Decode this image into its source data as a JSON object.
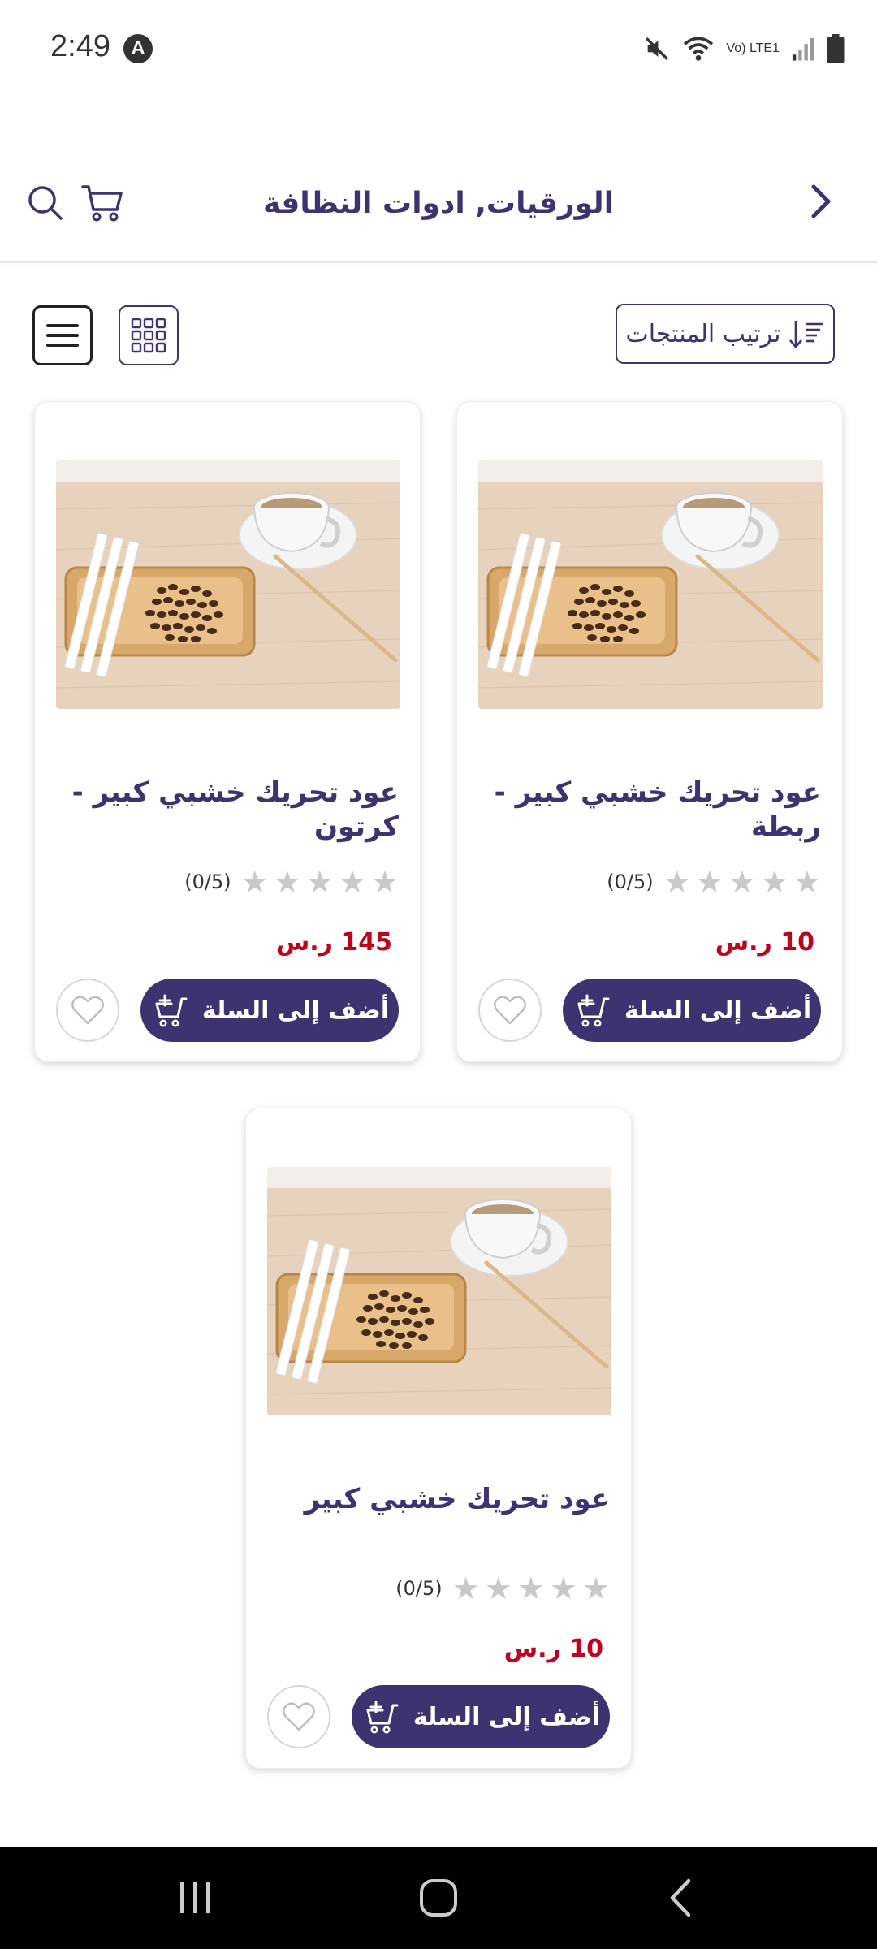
{
  "status_bar": {
    "time": "2:49",
    "app_badge": "A",
    "network_label": "Vo) LTE1",
    "icons": [
      "mute-icon",
      "wifi-icon",
      "signal-icon",
      "battery-icon"
    ]
  },
  "header": {
    "title": "الورقيات, ادوات النظافة",
    "icons": [
      "back-chevron-icon",
      "cart-icon",
      "search-icon"
    ]
  },
  "toolbar": {
    "sort_label": "ترتيب المنتجات",
    "view_modes": [
      "grid-view-icon",
      "list-view-icon"
    ]
  },
  "products": [
    {
      "title": "عود تحريك خشبي كبير - ربطة",
      "rating_text": "(0/5)",
      "rating_value": 0,
      "rating_max": 5,
      "price": "10 ر.س",
      "add_label": "أضف إلى السلة"
    },
    {
      "title": "عود تحريك خشبي كبير - كرتون",
      "rating_text": "(0/5)",
      "rating_value": 0,
      "rating_max": 5,
      "price": "145 ر.س",
      "add_label": "أضف إلى السلة"
    },
    {
      "title": "عود تحريك خشبي كبير",
      "rating_text": "(0/5)",
      "rating_value": 0,
      "rating_max": 5,
      "price": "10 ر.س",
      "add_label": "أضف إلى السلة"
    }
  ],
  "colors": {
    "brand": "#3b3470",
    "price": "#c0001a",
    "star_empty": "#c9c9c9"
  },
  "nav_bar": {
    "icons": [
      "recent-apps-icon",
      "home-icon",
      "back-icon"
    ]
  }
}
